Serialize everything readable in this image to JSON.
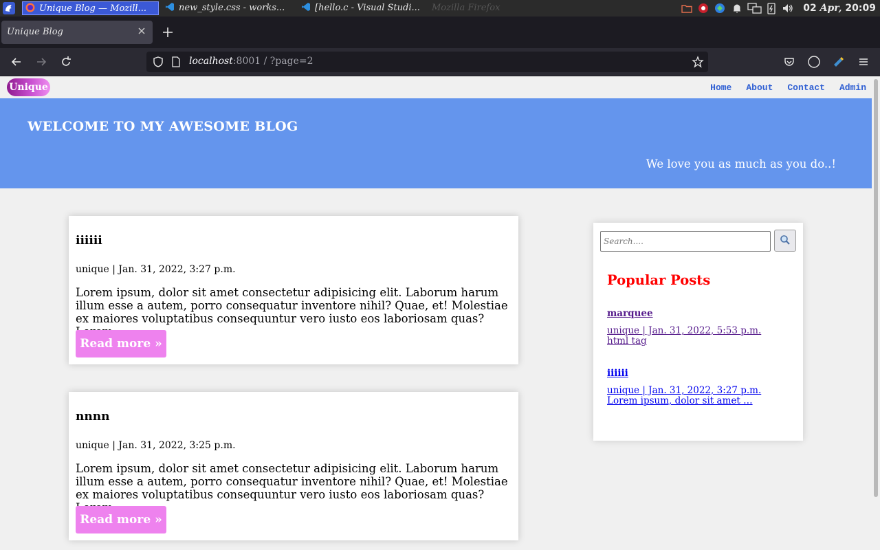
{
  "taskbar": {
    "windows": [
      {
        "label": "Unique Blog — Mozill...",
        "active": true
      },
      {
        "label": "new_style.css - works...",
        "active": false
      },
      {
        "label": "[hello.c - Visual Studi...",
        "active": false
      }
    ],
    "ghost_title": "Mozilla Firefox",
    "clock_date": "02",
    "clock_month": "Apr,",
    "clock_time": "20:09"
  },
  "browser": {
    "tab_title": "Unique Blog",
    "url_host": "localhost",
    "url_rest": ":8001 / ?page=2"
  },
  "site": {
    "logo": "Unique",
    "menu": [
      "Home",
      "About",
      "Contact",
      "Admin"
    ],
    "hero_title": "WELCOME TO MY AWESOME BLOG",
    "hero_subtitle": "We love you as much as you do..!"
  },
  "posts": [
    {
      "title": "iiiiii",
      "meta": "unique | Jan. 31, 2022, 3:27 p.m.",
      "excerpt": "Lorem ipsum, dolor sit amet consectetur adipisicing elit. Laborum harum illum esse a autem, porro consequatur inventore nihil? Quae, et! Molestiae ex maiores voluptatibus consequuntur vero iusto eos laboriosam quas?Lorem …",
      "button": "Read more »"
    },
    {
      "title": "nnnn",
      "meta": "unique | Jan. 31, 2022, 3:25 p.m.",
      "excerpt": "Lorem ipsum, dolor sit amet consectetur adipisicing elit. Laborum harum illum esse a autem, porro consequatur inventore nihil? Quae, et! Molestiae ex maiores voluptatibus consequuntur vero iusto eos laboriosam quas?Lorem …",
      "button": "Read more »"
    }
  ],
  "sidebar": {
    "search_placeholder": "Search....",
    "popular_heading": "Popular Posts",
    "popular": [
      {
        "title": "marquee",
        "meta": "unique | Jan. 31, 2022, 5:53 p.m.",
        "snippet": "html tag"
      },
      {
        "title": "iiiiii",
        "meta": "unique | Jan. 31, 2022, 3:27 p.m.",
        "snippet": "Lorem ipsum, dolor sit amet …"
      }
    ]
  },
  "colors": {
    "hero_bg": "#6495ed",
    "button_bg": "#ee82ee",
    "popular_heading": "#ff0000",
    "visited_link": "#551a8b",
    "link": "#0000ee",
    "menu_link": "#2f5fd3"
  }
}
